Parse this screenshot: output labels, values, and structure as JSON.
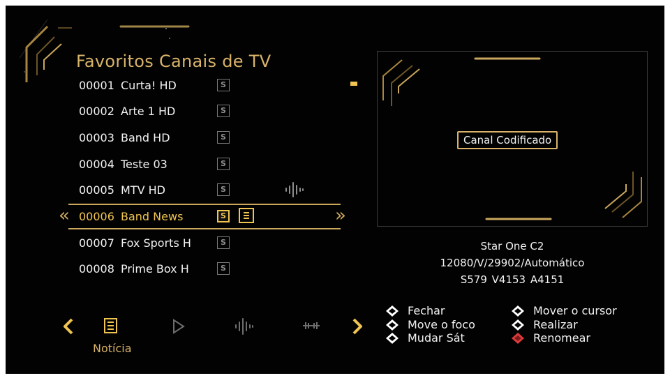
{
  "title": "Favoritos Canais de TV",
  "channels": [
    {
      "number": "00001",
      "name": "Curta! HD",
      "badge": "S"
    },
    {
      "number": "00002",
      "name": "Arte 1 HD",
      "badge": "S"
    },
    {
      "number": "00003",
      "name": "Band HD",
      "badge": "S"
    },
    {
      "number": "00004",
      "name": "Teste 03",
      "badge": "S"
    },
    {
      "number": "00005",
      "name": "MTV HD",
      "badge": "S"
    },
    {
      "number": "00006",
      "name": "Band News",
      "badge": "S"
    },
    {
      "number": "00007",
      "name": "Fox Sports H",
      "badge": "S"
    },
    {
      "number": "00008",
      "name": "Prime Box H",
      "badge": "S"
    }
  ],
  "selected_index": 5,
  "preview": {
    "status": "Canal Codificado"
  },
  "sat_info": {
    "satellite": "Star One C2",
    "transponder": "12080/V/29902/Automático",
    "pids": "S579  V4153  A4151"
  },
  "bottom_bar": {
    "active_label": "Notícia",
    "icons": [
      "chevron-left-icon",
      "news-icon",
      "play-icon",
      "audio-wave-icon",
      "equalizer-icon",
      "chevron-right-icon"
    ]
  },
  "legend": [
    {
      "label": "Fechar",
      "icon": "remote-white-icon",
      "color": "#ffffff"
    },
    {
      "label": "Move o foco",
      "icon": "remote-white-icon",
      "color": "#ffffff"
    },
    {
      "label": "Mudar Sát",
      "icon": "remote-white-icon",
      "color": "#ffffff"
    },
    {
      "label": "Mover o cursor",
      "icon": "remote-white-icon",
      "color": "#ffffff"
    },
    {
      "label": "Realizar",
      "icon": "remote-white-icon",
      "color": "#ffffff"
    },
    {
      "label": "Renomear",
      "icon": "remote-red-icon",
      "color": "#e03a3a"
    }
  ],
  "colors": {
    "accent": "#f0c451",
    "gold": "#d9b36a",
    "text": "#f2f2f2",
    "background": "#020202"
  }
}
